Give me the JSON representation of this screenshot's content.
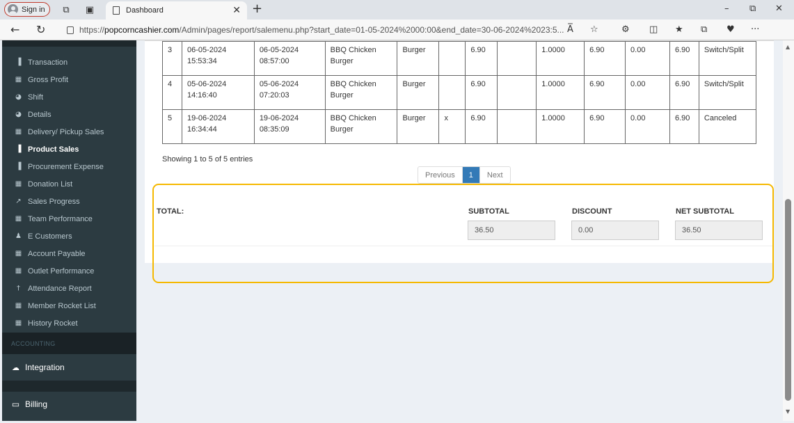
{
  "browser": {
    "sign_in": "Sign in",
    "tab_title": "Dashboard",
    "url_prefix": "https://",
    "url_host": "popcorncashier.com",
    "url_path": "/Admin/pages/report/salemenu.php?start_date=01-05-2024%2000:00&end_date=30-06-2024%2023:5...",
    "read_aloud": "A̅",
    "more": "···"
  },
  "sidebar": {
    "items": [
      {
        "label": "Transaction",
        "icon": "bar-chart-icon",
        "glyph": "▐"
      },
      {
        "label": "Gross Profit",
        "icon": "table-icon",
        "glyph": "▦"
      },
      {
        "label": "Shift",
        "icon": "pie-chart-icon",
        "glyph": "◕"
      },
      {
        "label": "Details",
        "icon": "pie-chart-icon",
        "glyph": "◕"
      },
      {
        "label": "Delivery/ Pickup Sales",
        "icon": "table-icon",
        "glyph": "▦"
      },
      {
        "label": "Product Sales",
        "icon": "bar-chart-icon",
        "glyph": "▐"
      },
      {
        "label": "Procurement Expense",
        "icon": "bar-chart-icon",
        "glyph": "▐"
      },
      {
        "label": "Donation List",
        "icon": "table-icon",
        "glyph": "▦"
      },
      {
        "label": "Sales Progress",
        "icon": "line-chart-icon",
        "glyph": "↗"
      },
      {
        "label": "Team Performance",
        "icon": "table-icon",
        "glyph": "▦"
      },
      {
        "label": "E Customers",
        "icon": "users-icon",
        "glyph": "♟"
      },
      {
        "label": "Account Payable",
        "icon": "table-icon",
        "glyph": "▦"
      },
      {
        "label": "Outlet Performance",
        "icon": "table-icon",
        "glyph": "▦"
      },
      {
        "label": "Attendance Report",
        "icon": "person-icon",
        "glyph": "†"
      },
      {
        "label": "Member Rocket List",
        "icon": "table-icon",
        "glyph": "▦"
      },
      {
        "label": "History Rocket",
        "icon": "table-icon",
        "glyph": "▦"
      }
    ],
    "section_accounting": "ACCOUNTING",
    "integration": "Integration",
    "billing": "Billing"
  },
  "table": {
    "rows": [
      {
        "no": "3",
        "date1": "06-05-2024",
        "time1": "15:53:34",
        "date2": "06-05-2024",
        "time2": "08:57:00",
        "menu1": "BBQ Chicken",
        "menu2": "Burger",
        "category": "Burger",
        "mark": "",
        "price": "6.90",
        "blank": "",
        "qty": "1.0000",
        "subtotal": "6.90",
        "discount": "0.00",
        "net": "6.90",
        "status": "Switch/Split"
      },
      {
        "no": "4",
        "date1": "05-06-2024",
        "time1": "14:16:40",
        "date2": "05-06-2024",
        "time2": "07:20:03",
        "menu1": "BBQ Chicken",
        "menu2": "Burger",
        "category": "Burger",
        "mark": "",
        "price": "6.90",
        "blank": "",
        "qty": "1.0000",
        "subtotal": "6.90",
        "discount": "0.00",
        "net": "6.90",
        "status": "Switch/Split"
      },
      {
        "no": "5",
        "date1": "19-06-2024",
        "time1": "16:34:44",
        "date2": "19-06-2024",
        "time2": "08:35:09",
        "menu1": "BBQ Chicken",
        "menu2": "Burger",
        "category": "Burger",
        "mark": "x",
        "price": "6.90",
        "blank": "",
        "qty": "1.0000",
        "subtotal": "6.90",
        "discount": "0.00",
        "net": "6.90",
        "status": "Canceled"
      }
    ],
    "entries": "Showing 1 to 5 of 5 entries",
    "pager": {
      "previous": "Previous",
      "page": "1",
      "next": "Next"
    }
  },
  "totals": {
    "label": "TOTAL:",
    "subtotal_label": "SUBTOTAL",
    "discount_label": "DISCOUNT",
    "net_label": "NET SUBTOTAL",
    "subtotal_value": "36.50",
    "discount_value": "0.00",
    "net_value": "36.50"
  },
  "colors": {
    "highlight": "#f5b800",
    "sidebar_bg": "#2c3b41",
    "pager_active": "#337ab7"
  }
}
